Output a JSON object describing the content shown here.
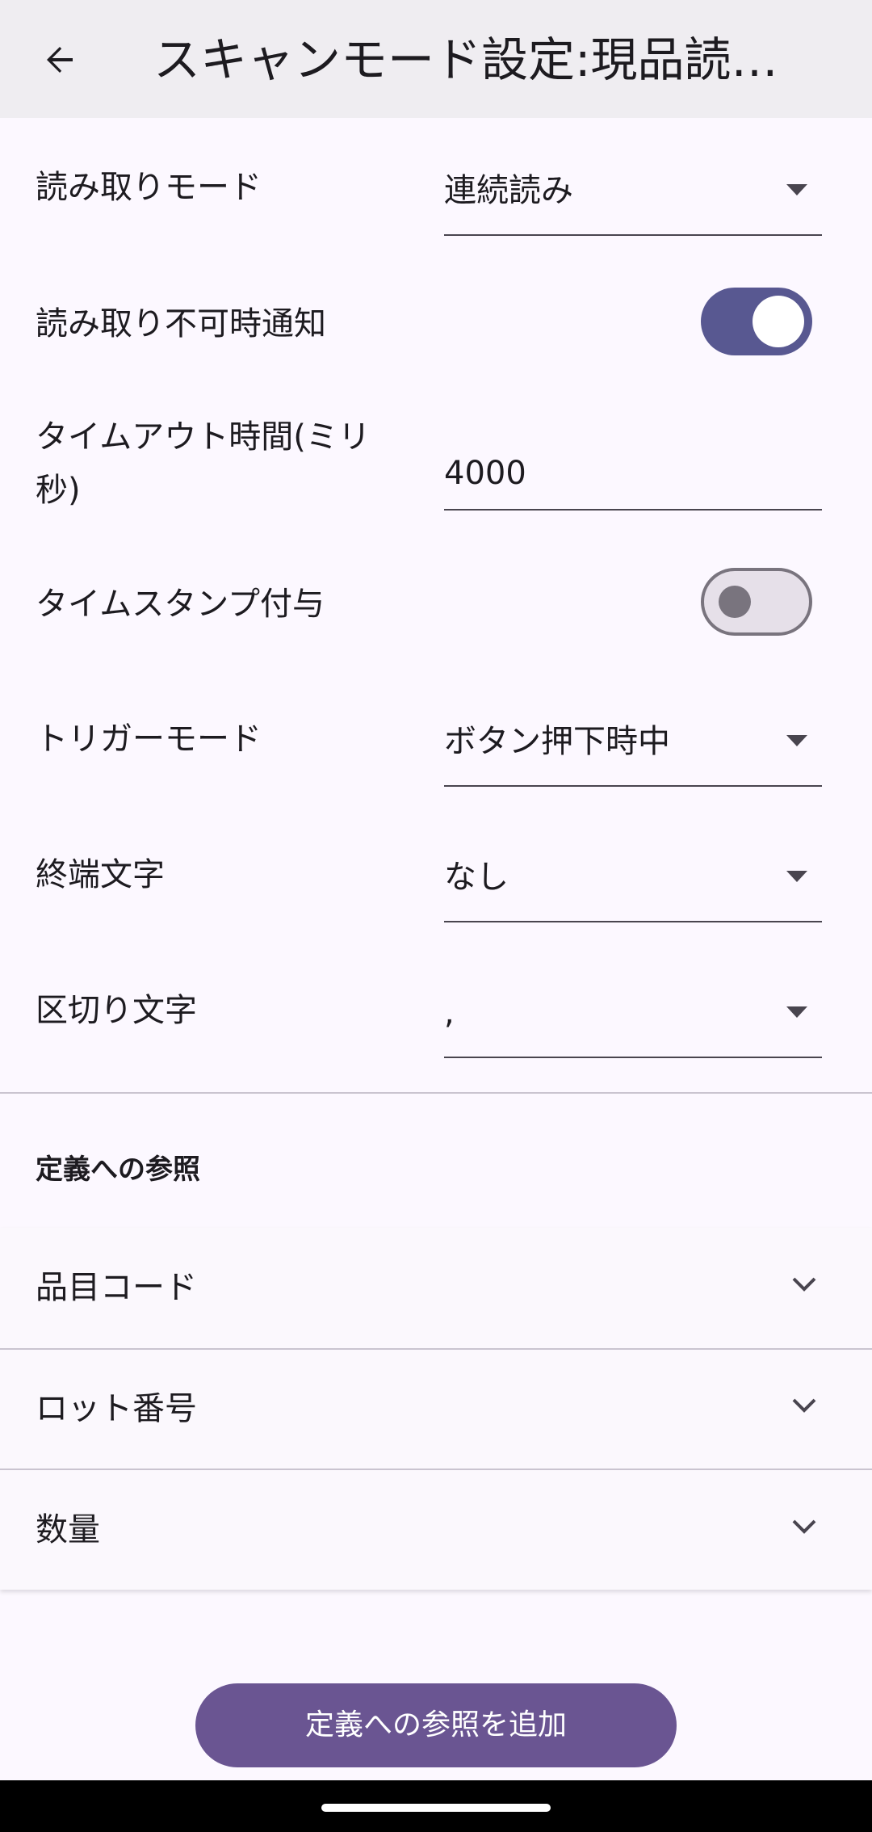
{
  "header": {
    "title": "スキャンモード設定:現品読み…"
  },
  "settings": {
    "read_mode": {
      "label": "読み取りモード",
      "value": "連続読み"
    },
    "unreadable_notify": {
      "label": "読み取り不可時通知",
      "enabled": true
    },
    "timeout": {
      "label": "タイムアウト時間(ミリ秒)",
      "value": "4000"
    },
    "timestamp": {
      "label": "タイムスタンプ付与",
      "enabled": false
    },
    "trigger_mode": {
      "label": "トリガーモード",
      "value": "ボタン押下時中"
    },
    "terminator": {
      "label": "終端文字",
      "value": "なし"
    },
    "separator": {
      "label": "区切り文字",
      "value": ","
    }
  },
  "references": {
    "section_title": "定義への参照",
    "items": [
      {
        "label": "品目コード"
      },
      {
        "label": "ロット番号"
      },
      {
        "label": "数量"
      }
    ],
    "add_button": "定義への参照を追加"
  },
  "colors": {
    "accent": "#585891",
    "button": "#6a5592",
    "topbar": "#efedf1",
    "background": "#fcf8ff"
  }
}
